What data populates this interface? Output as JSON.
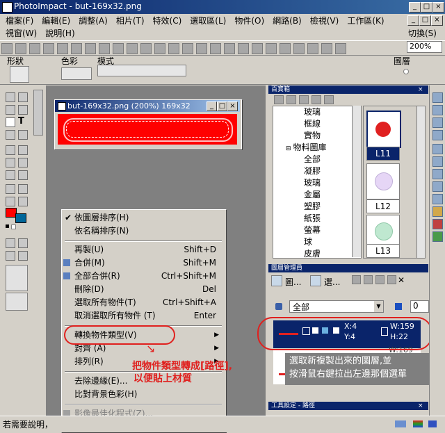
{
  "window": {
    "title": "PhotoImpact - but-169x32.png"
  },
  "menu_row1": [
    "檔案(F)",
    "編輯(E)",
    "調整(A)",
    "相片(T)",
    "特效(C)",
    "選取區(L)",
    "物件(O)",
    "網路(B)",
    "檢視(V)",
    "工作區(K)"
  ],
  "menu_row2": [
    "視窗(W)",
    "說明(H)"
  ],
  "menu_right": "切換(S)",
  "toolbar": {
    "zoom_value": "200%"
  },
  "props": {
    "shape_label": "形狀",
    "color_label": "色彩",
    "mode_label": "模式",
    "layer_label": "圖層"
  },
  "image_window": {
    "title": "but-169x32.png (200%) 169x32"
  },
  "context_menu": {
    "items": [
      {
        "label": "依圖層排序(H)",
        "shortcut": "",
        "checked": true
      },
      {
        "label": "依名稱排序(N)",
        "shortcut": ""
      },
      {
        "label": "再製(U)",
        "shortcut": "Shift+D"
      },
      {
        "label": "合併(M)",
        "shortcut": "Shift+M"
      },
      {
        "label": "全部合併(R)",
        "shortcut": "Ctrl+Shift+M"
      },
      {
        "label": "刪除(D)",
        "shortcut": "Del"
      },
      {
        "label": "選取所有物件(T)",
        "shortcut": "Ctrl+Shift+A"
      },
      {
        "label": "取消選取所有物件 (T)",
        "shortcut": "Enter"
      },
      {
        "label": "轉換物件類型(V)",
        "shortcut": ""
      },
      {
        "label": "對齊 (A)",
        "shortcut": ""
      },
      {
        "label": "排列(R)",
        "shortcut": ""
      },
      {
        "label": "去除邊緣(E)...",
        "shortcut": ""
      },
      {
        "label": "比對背景色彩(H)",
        "shortcut": ""
      },
      {
        "label": "影像最佳化程式(Z)...",
        "shortcut": ""
      }
    ]
  },
  "annotations": {
    "convert_note_line1": "把物件類型轉成[路徑],",
    "convert_note_line2": "以便貼上材質",
    "layer_note_line1": "選取新複製出來的圖層,並",
    "layer_note_line2": "按滑鼠右鍵拉出左邊那個選單"
  },
  "treasure_panel": {
    "title": "百寶箱",
    "tree": [
      "玻璃",
      "框線",
      "實物",
      "物料圖庫",
      "全部",
      "凝膠",
      "玻璃",
      "金屬",
      "塑膠",
      "紙張",
      "螢幕",
      "球",
      "皮膚"
    ],
    "thumb_labels": [
      "L11",
      "L12",
      "L13"
    ]
  },
  "layer_panel": {
    "title": "圖層管理員",
    "tab1": "圖...",
    "tab2": "選...",
    "filter_value": "全部",
    "opacity_value": "0",
    "layer": {
      "x": "X:4",
      "y": "Y:4",
      "w": "W:159",
      "h": "H:22"
    },
    "next_w": "W:169",
    "next_h": "H:32"
  },
  "tool_settings_title": "工具設定 - 路徑",
  "status": {
    "text": "若需要說明，"
  }
}
